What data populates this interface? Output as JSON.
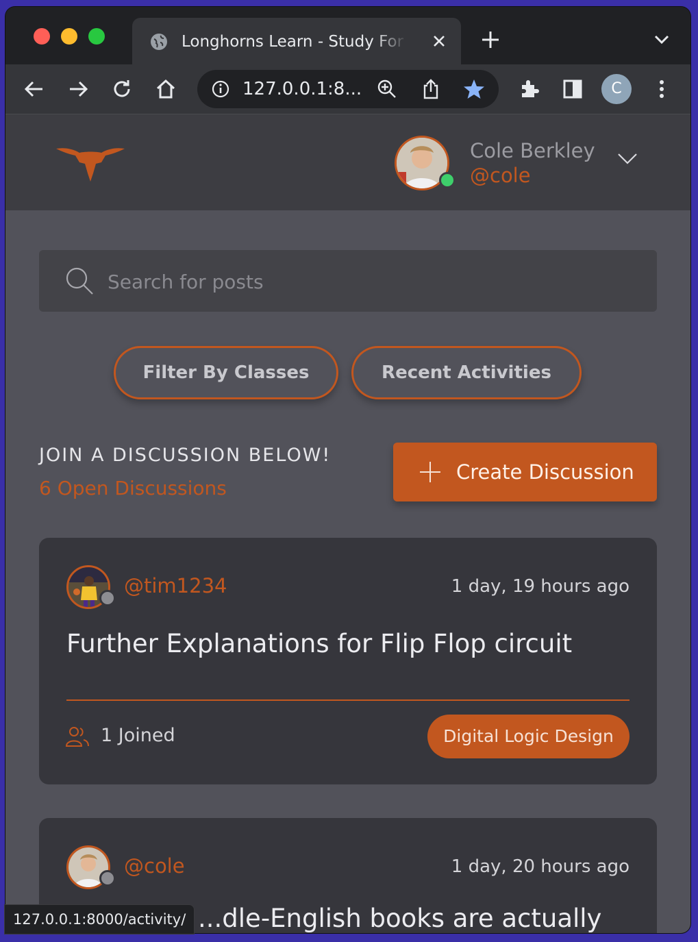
{
  "browser": {
    "tab_title": "Longhorns Learn - Study For A",
    "url_display": "127.0.0.1:8...",
    "profile_initial": "C",
    "status_url": "127.0.0.1:8000/activity/"
  },
  "header": {
    "user_name": "Cole Berkley",
    "user_handle": "@cole"
  },
  "search": {
    "placeholder": "Search for posts"
  },
  "filters": {
    "filter_label": "Filter By Classes",
    "recent_label": "Recent Activities"
  },
  "discussions": {
    "heading": "JOIN A DISCUSSION BELOW!",
    "open_count": "6 Open Discussions",
    "create_label": "Create Discussion",
    "posts": [
      {
        "handle": "@tim1234",
        "time": "1 day, 19 hours ago",
        "title": "Further Explanations for Flip Flop circuit",
        "joined": "1 Joined",
        "tag": "Digital Logic Design"
      },
      {
        "handle": "@cole",
        "time": "1 day, 20 hours ago",
        "title": "...dle-English books are actually"
      }
    ]
  },
  "colors": {
    "accent": "#c2571f",
    "page_bg": "#52525a",
    "card_bg": "#36363c"
  }
}
